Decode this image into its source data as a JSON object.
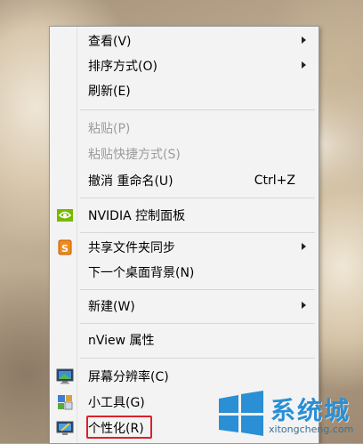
{
  "menu": {
    "items": [
      {
        "label": "查看(V)",
        "submenu": true
      },
      {
        "label": "排序方式(O)",
        "submenu": true
      },
      {
        "label": "刷新(E)"
      },
      {
        "label": "粘贴(P)",
        "disabled": true
      },
      {
        "label": "粘贴快捷方式(S)",
        "disabled": true
      },
      {
        "label": "撤消 重命名(U)",
        "shortcut": "Ctrl+Z"
      },
      {
        "label": "NVIDIA 控制面板",
        "icon": "nvidia-icon"
      },
      {
        "label": "共享文件夹同步",
        "icon": "sync-folder-icon",
        "submenu": true
      },
      {
        "label": "下一个桌面背景(N)"
      },
      {
        "label": "新建(W)",
        "submenu": true
      },
      {
        "label": "nView 属性"
      },
      {
        "label": "屏幕分辨率(C)",
        "icon": "monitor-icon"
      },
      {
        "label": "小工具(G)",
        "icon": "gadgets-icon"
      },
      {
        "label": "个性化(R)",
        "icon": "personalize-icon",
        "highlighted": true
      }
    ]
  },
  "watermark": {
    "text": "系统城",
    "subtext": "xitongcheng.com",
    "color": "#2a8fd4"
  },
  "colors": {
    "menu_bg": "#f3f3f3",
    "highlight_border": "#d6232b",
    "nvidia_green": "#76b900"
  }
}
